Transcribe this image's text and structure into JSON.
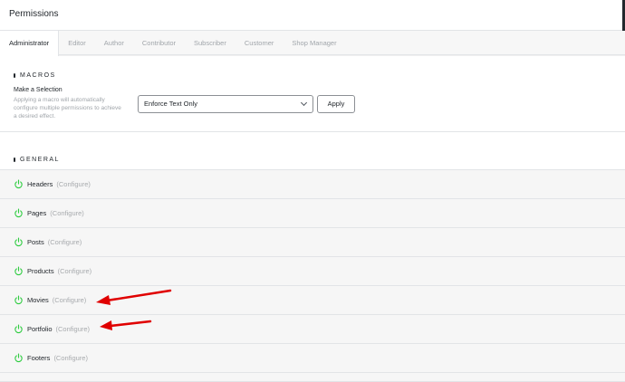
{
  "header": {
    "title": "Permissions"
  },
  "tabs": [
    {
      "label": "Administrator",
      "active": true
    },
    {
      "label": "Editor",
      "active": false
    },
    {
      "label": "Author",
      "active": false
    },
    {
      "label": "Contributor",
      "active": false
    },
    {
      "label": "Subscriber",
      "active": false
    },
    {
      "label": "Customer",
      "active": false
    },
    {
      "label": "Shop Manager",
      "active": false
    }
  ],
  "macros": {
    "heading": "MACROS",
    "label": "Make a Selection",
    "description": "Applying a macro will automatically configure multiple permissions to achieve a desired effect.",
    "selected": "Enforce Text Only",
    "apply_label": "Apply"
  },
  "general": {
    "heading": "GENERAL",
    "items": [
      {
        "name": "Headers",
        "configure": "(Configure)"
      },
      {
        "name": "Pages",
        "configure": "(Configure)"
      },
      {
        "name": "Posts",
        "configure": "(Configure)"
      },
      {
        "name": "Products",
        "configure": "(Configure)"
      },
      {
        "name": "Movies",
        "configure": "(Configure)"
      },
      {
        "name": "Portfolio",
        "configure": "(Configure)"
      },
      {
        "name": "Footers",
        "configure": "(Configure)"
      }
    ]
  },
  "colors": {
    "power_icon": "#2ecc40",
    "annotation_arrow": "#e00000"
  }
}
